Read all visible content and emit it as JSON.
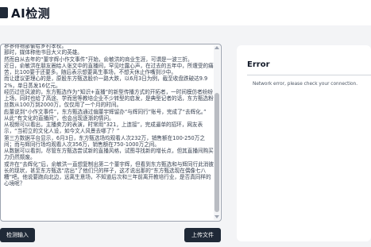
{
  "header": {
    "title": "AI检测"
  },
  "editor": {
    "content": "寥寥得物部偷给乡村孝校。\n那时，媒体称他书目大义的英雄。\n然而自从去年的“董宇辉小作文事件”开始，俞敏洪的商业生涯，可谓是一波三折。\n近日，俞敏洪在朋友圈给人张文中的直播间，罕见吐露心声，在过去的五年中，所遭受的痛苦，比100要于还要多。随后表示想要离生事场，不想天休止作嘴到沙中。\n而让建议更理心的是，原股东方甄选股价一路大跌，以6月3日为例，截至收盘跌破达9.92%，单日蒸发16亿元。\n经历过往风波的，东方甄选作为“知识+直播”的新型传播方式的开拓者，一时间模仿者纷纷上场，同时也给了高途、学而思等教培企业不少转型的启发，是典型记者的话，东方甄选粉丝数从100万到2000万，仅仅用了一个月的时间。\n彪董说到“小作文事件”，东方甄选通过偏董宇辉留办“与辉同行”账号，完成了“去辉化。”\n从此“有文化的直播间”，也会出现逐渐的情问。\n从视频可以看出，主播卖力的表演，时常用“321，上连接”，完成逼单的招环，网友表示，“当初立的文化人设，如今文人风景去哪了？”\n第三方数据平台显示，6月3日，东方甄选场均观看人次232万，销售额在100-250万之间；而与辉同行场均观看人次356万，销售额在750-1000万之间。\n从数据可以看到，尽管东方甄选尝试新的直播风格，试图寻找新的增长点，但其直播间购买力仍然颓废。\n或许在“去辉化”后，俞敏洪一直想复制出第二个董宇辉，但看到东方甄选和与辉同行此消彼长的现状，甚至东方甄选“店出”了他们只的样子，这才说出那的“东方甄选现在偶像七八糟”吧。他说要跑向北边，远离生意场，不知道后次和三年前离开教培行业，是否真同样的心境呢？"
  },
  "buttons": {
    "detect": "检测输入",
    "upload": "上传文件"
  },
  "result": {
    "title": "Error",
    "message": "Network error, please check your connection."
  }
}
